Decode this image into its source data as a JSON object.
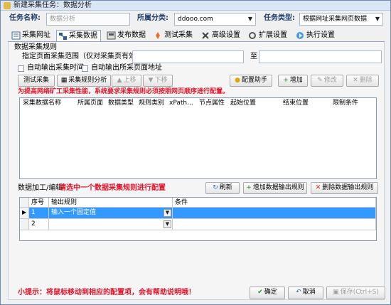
{
  "window": {
    "title": "新建采集任务：数据分析"
  },
  "task": {
    "name_label": "任务名称:",
    "name_value": "数据分析",
    "category_label": "所属分类:",
    "category_value": "ddooo.com",
    "type_label": "任务类型:",
    "type_value": "根据网址采集网页数据"
  },
  "tabs": [
    {
      "label": "采集网址",
      "icon": "list-icon"
    },
    {
      "label": "采集数据",
      "icon": "data-icon"
    },
    {
      "label": "发布数据",
      "icon": "publish-icon"
    },
    {
      "label": "测试采集",
      "icon": "test-icon"
    },
    {
      "label": "高级设置",
      "icon": "tools-icon"
    },
    {
      "label": "扩展设置",
      "icon": "extension-icon"
    },
    {
      "label": "执行设置",
      "icon": "execute-icon"
    }
  ],
  "rules": {
    "section_label": "数据采集规则",
    "range_label": "指定页面采集范围（仅对采集页有效）:",
    "range_from": "",
    "range_to_label": "至",
    "range_to": "",
    "auto_time_label": "自动输出采集时间",
    "auto_url_label": "自动输出所采页面地址",
    "test_button": "测试采集",
    "analyze_button": "采集规则分析",
    "up_button": "上移",
    "down_button": "下移",
    "config_button": "配置助手",
    "add_button": "增加",
    "edit_button": "修改",
    "delete_button": "删除",
    "warning": "为提高网络矿工采集性能，系统要求采集规则必须按照网页顺序进行配置。",
    "columns": [
      "采集数据名称",
      "所属页面",
      "数据类型",
      "规则类别",
      "xPath...",
      "节点属性",
      "起始位置",
      "结束位置",
      "限制条件"
    ]
  },
  "output": {
    "label": "数据加工/编辑",
    "hint": "请选中一个数据采集规则进行配置",
    "refresh_button": "刷新",
    "add_button": "增加数据输出规则",
    "delete_button": "删除数据输出规则",
    "columns": [
      "序号",
      "输出规则",
      "条件"
    ],
    "rows": [
      {
        "index": "1",
        "rule": "输入一个固定值",
        "condition": ""
      },
      {
        "index": "2",
        "rule": "",
        "condition": ""
      }
    ]
  },
  "footer": {
    "tip": "小提示：将鼠标移动到相应的配置项，会有帮助说明哦！",
    "ok_button": "确定",
    "cancel_button": "取消",
    "save_button": "保存(Ctrl+S)"
  },
  "colors": {
    "warning": "#e0142a",
    "selection": "#3399ff",
    "label": "#1f3e6e"
  }
}
